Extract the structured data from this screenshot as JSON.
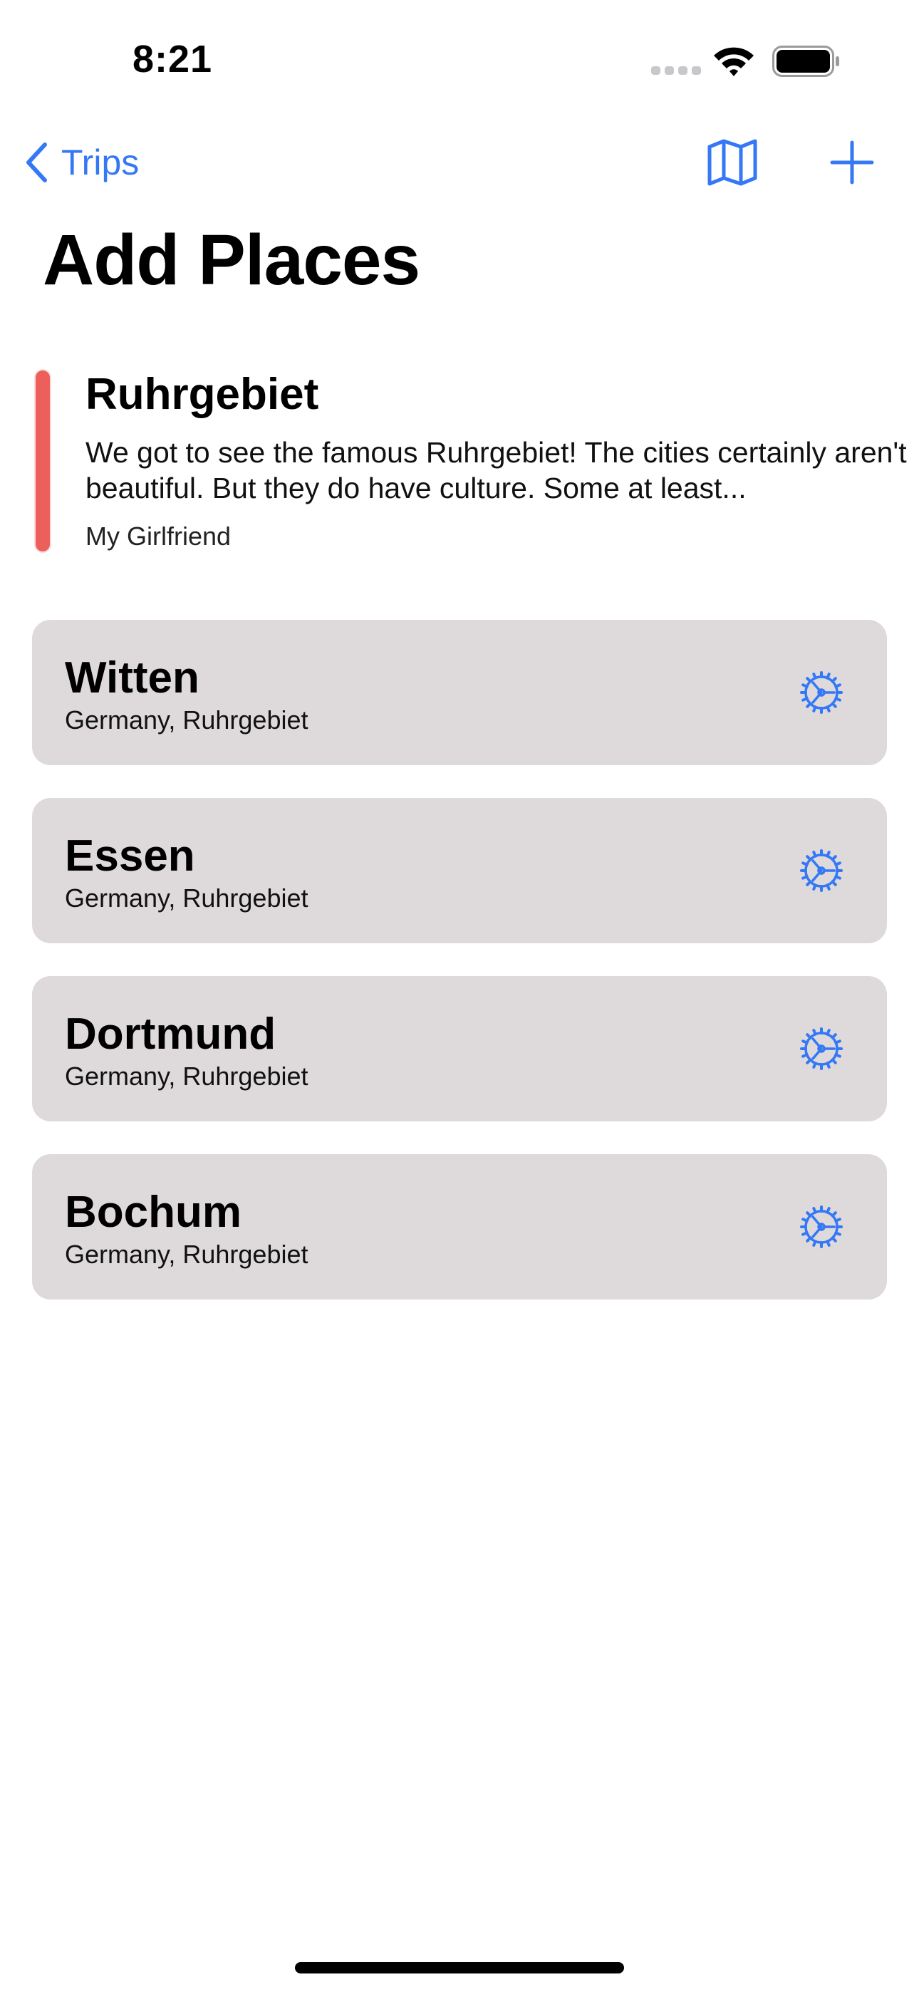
{
  "status_bar": {
    "time": "8:21"
  },
  "nav": {
    "back_label": "Trips",
    "back_icon": "chevron-left-icon",
    "map_icon": "map-icon",
    "add_icon": "plus-icon",
    "accent": "#3478f6"
  },
  "page_title": "Add Places",
  "trip": {
    "title": "Ruhrgebiet",
    "description": "We got to see the famous Ruhrgebiet! The cities certainly aren't beautiful. But they do have culture. Some at least...",
    "author": "My Girlfriend",
    "color": "#ed5f5b"
  },
  "places": [
    {
      "name": "Witten",
      "subtitle": "Germany, Ruhrgebiet",
      "icon": "gear-icon"
    },
    {
      "name": "Essen",
      "subtitle": "Germany, Ruhrgebiet",
      "icon": "gear-icon"
    },
    {
      "name": "Dortmund",
      "subtitle": "Germany, Ruhrgebiet",
      "icon": "gear-icon"
    },
    {
      "name": "Bochum",
      "subtitle": "Germany, Ruhrgebiet",
      "icon": "gear-icon"
    }
  ]
}
